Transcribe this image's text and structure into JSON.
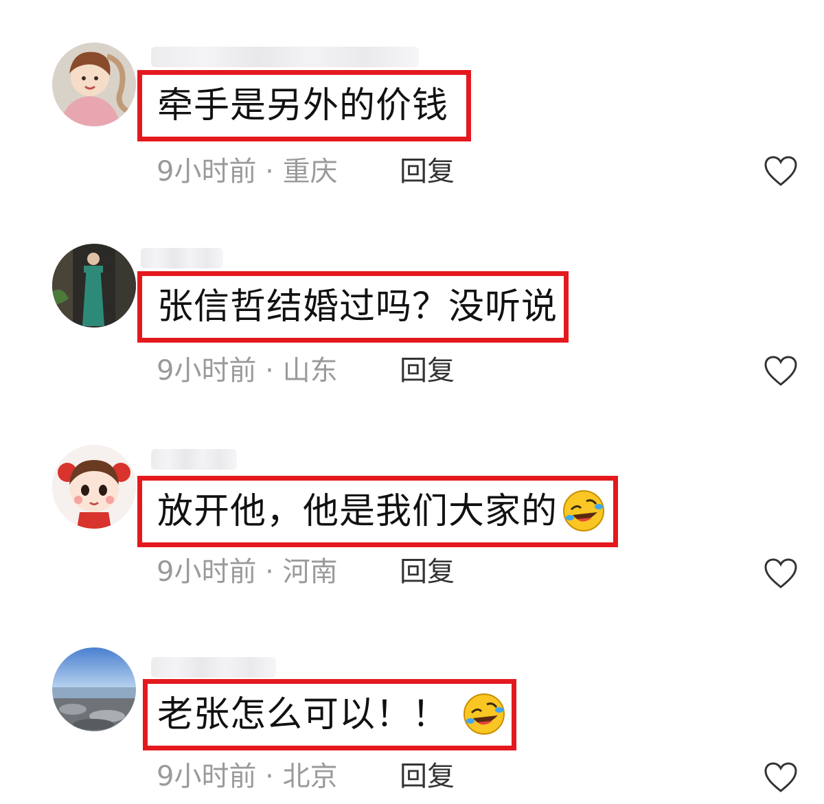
{
  "comments": [
    {
      "text": "牵手是另外的价钱",
      "time": "9小时前",
      "separator": "·",
      "location": "重庆",
      "reply_label": "回复",
      "has_emoji": false,
      "avatar": "cartoon-girl-avatar"
    },
    {
      "text": "张信哲结婚过吗？没听说",
      "time": "9小时前",
      "separator": "·",
      "location": "山东",
      "reply_label": "回复",
      "has_emoji": false,
      "avatar": "woman-green-dress-avatar"
    },
    {
      "text": "放开他，他是我们大家的",
      "time": "9小时前",
      "separator": "·",
      "location": "河南",
      "reply_label": "回复",
      "has_emoji": true,
      "avatar": "cartoon-girl-red-bows-avatar"
    },
    {
      "text": "老张怎么可以！！",
      "time": "9小时前",
      "separator": "·",
      "location": "北京",
      "reply_label": "回复",
      "has_emoji": true,
      "avatar": "seascape-avatar"
    }
  ],
  "colors": {
    "highlight_border": "#e3191e",
    "meta_text": "#9a9a9a",
    "reply_text": "#333333",
    "comment_text": "#111111"
  },
  "icons": {
    "emoji": "rolling-laughing-emoji-icon",
    "like": "heart-outline-icon"
  }
}
